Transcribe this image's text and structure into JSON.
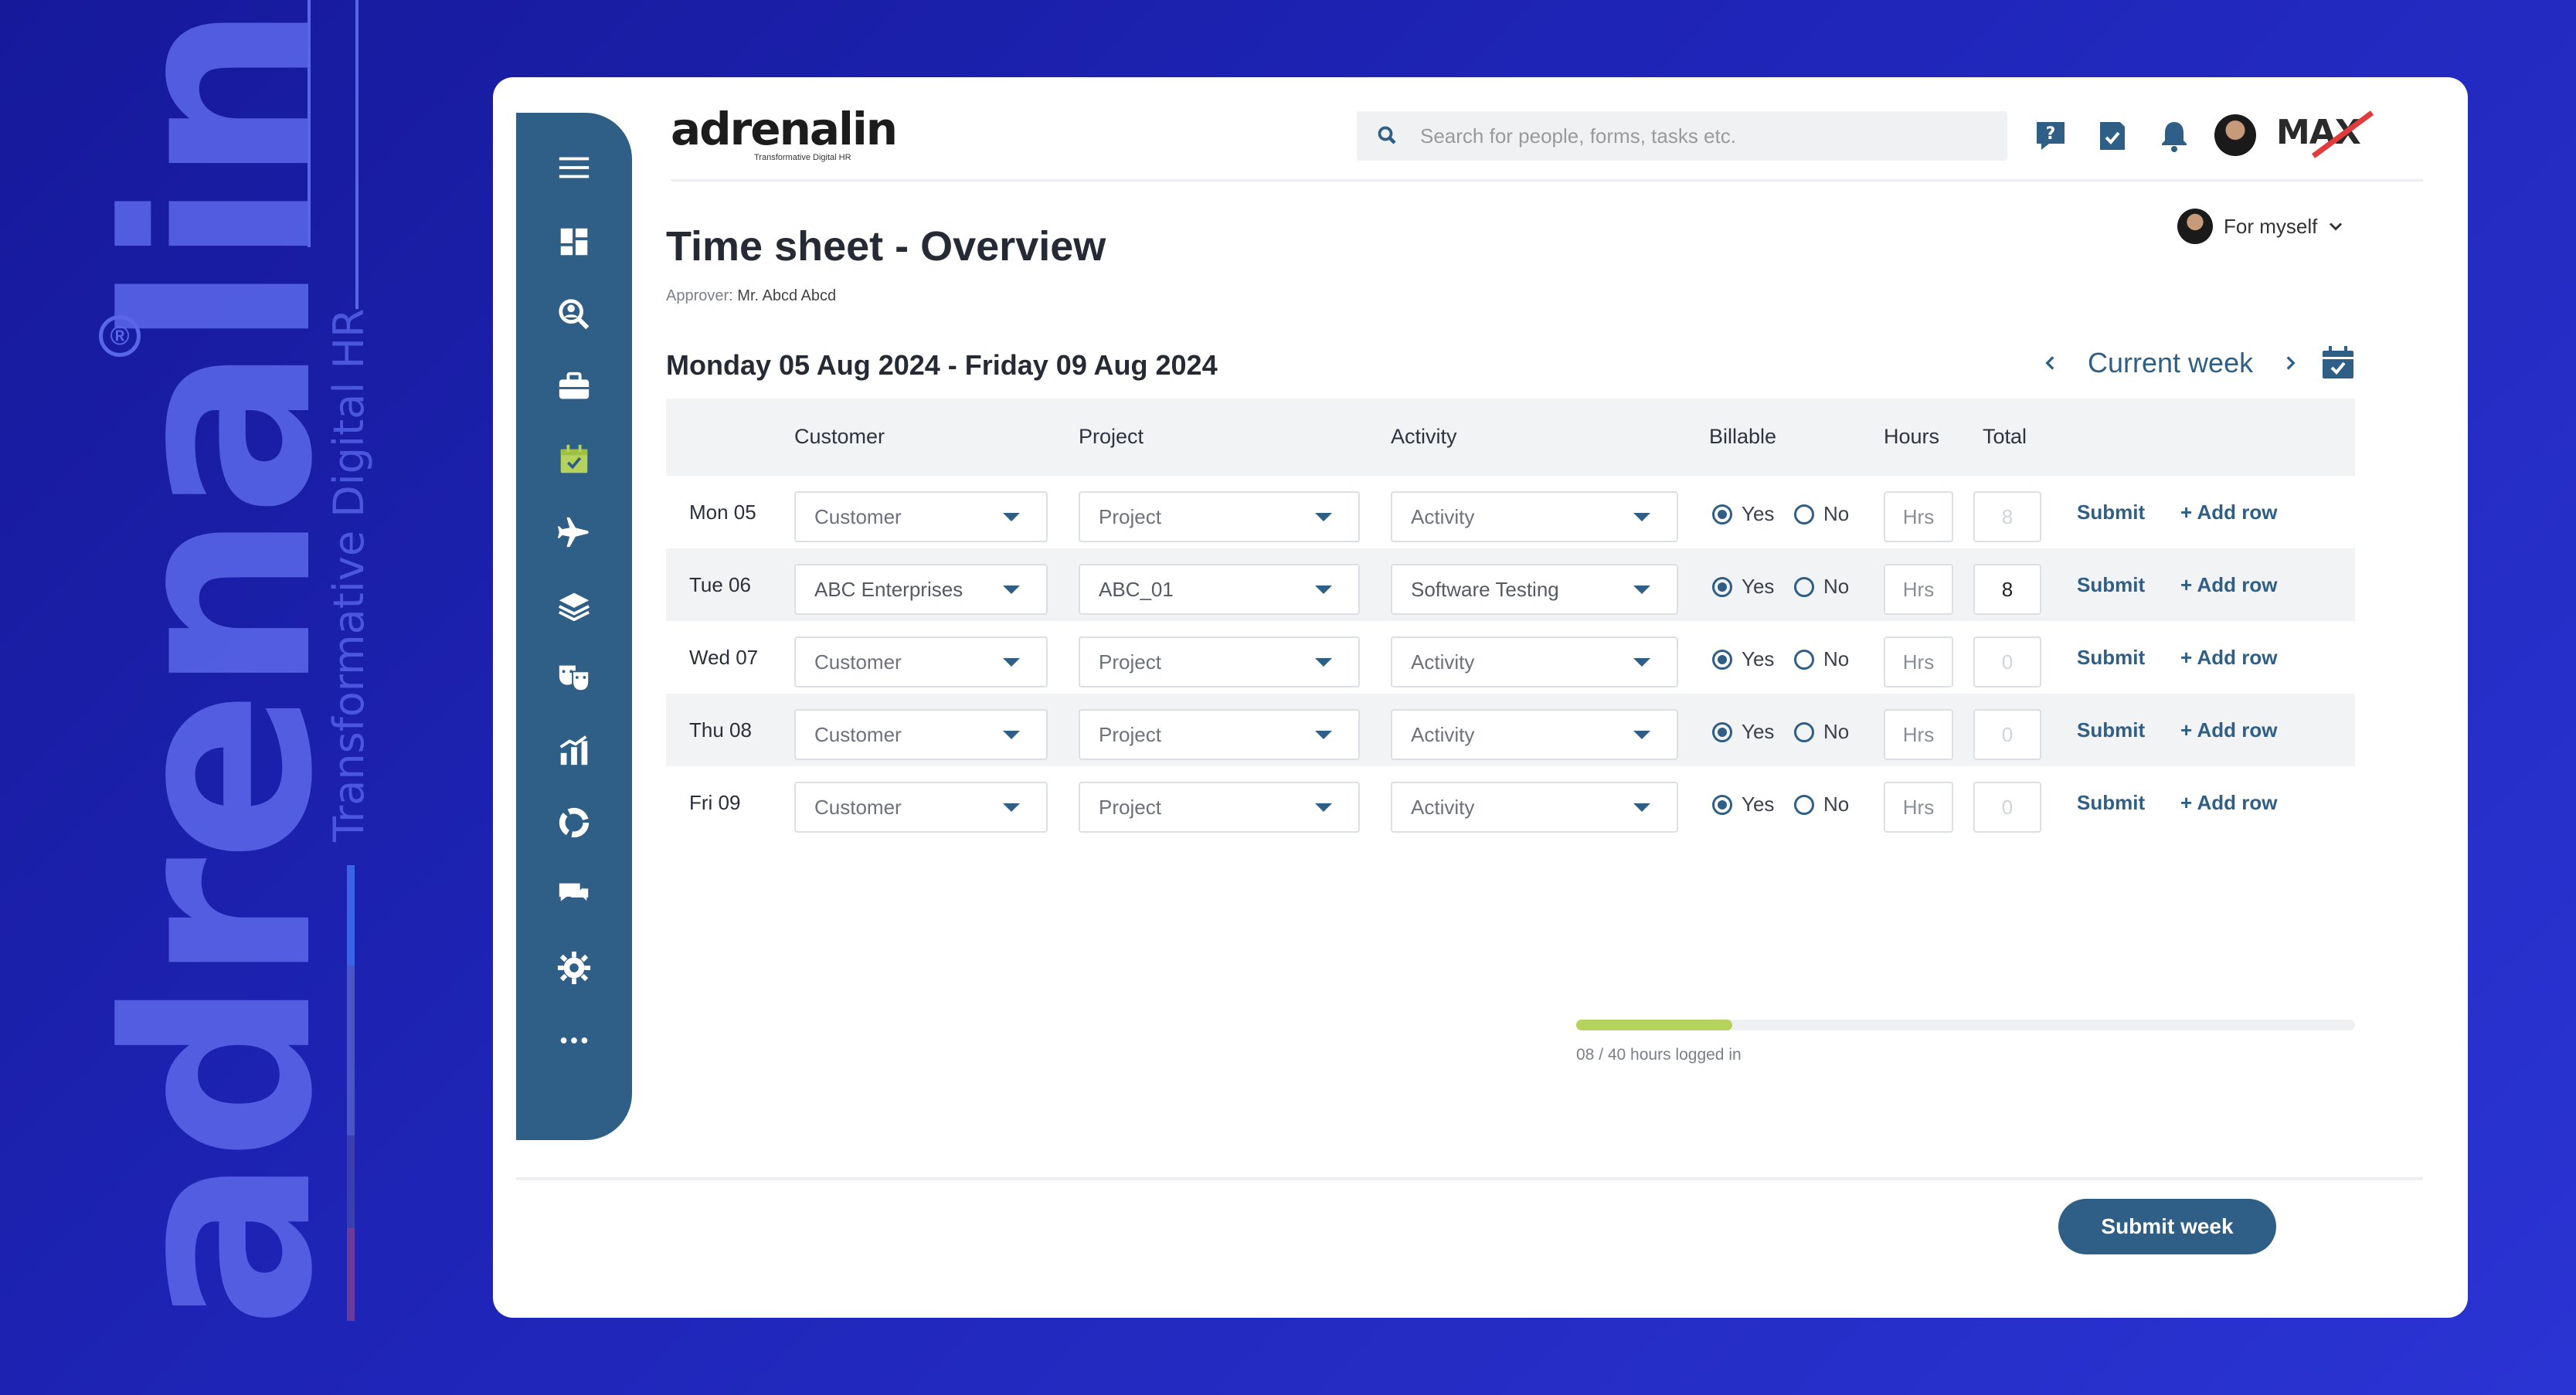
{
  "brand": {
    "name": "adrenalin",
    "registered": "®",
    "tagline": "Transformative Digital HR"
  },
  "header": {
    "logo_text": "adrenalin",
    "logo_sub": "Transformative Digital HR",
    "search_placeholder": "Search for people, forms, tasks etc.",
    "max_logo": "MAX"
  },
  "page": {
    "title": "Time sheet - Overview",
    "approver_label": "Approver:",
    "approver_name": "Mr. Abcd Abcd",
    "for_myself": "For myself",
    "week_range": "Monday 05 Aug 2024 - Friday 09 Aug 2024",
    "current_week": "Current week"
  },
  "table": {
    "headers": {
      "customer": "Customer",
      "project": "Project",
      "activity": "Activity",
      "billable": "Billable",
      "hours": "Hours",
      "total": "Total"
    },
    "yes_label": "Yes",
    "no_label": "No",
    "submit_label": "Submit",
    "add_row_label": "+ Add row",
    "rows": [
      {
        "day": "Mon 05",
        "customer": "Customer",
        "project": "Project",
        "activity": "Activity",
        "hours": "Hrs",
        "total": "8"
      },
      {
        "day": "Tue 06",
        "customer": "ABC Enterprises",
        "project": "ABC_01",
        "activity": "Software Testing",
        "hours": "Hrs",
        "total": "8"
      },
      {
        "day": "Wed 07",
        "customer": "Customer",
        "project": "Project",
        "activity": "Activity",
        "hours": "Hrs",
        "total": "0"
      },
      {
        "day": "Thu 08",
        "customer": "Customer",
        "project": "Project",
        "activity": "Activity",
        "hours": "Hrs",
        "total": "0"
      },
      {
        "day": "Fri  09",
        "customer": "Customer",
        "project": "Project",
        "activity": "Activity",
        "hours": "Hrs",
        "total": "0"
      }
    ]
  },
  "progress": {
    "label": "08 / 40 hours logged in",
    "logged": 8,
    "total": 40,
    "color": "#b5d25c"
  },
  "footer": {
    "submit_week": "Submit week"
  },
  "colors": {
    "primary": "#2f5f86",
    "accent_green": "#b5d25c",
    "background": "#1f25b8"
  },
  "sidebar_icons": [
    "menu-icon",
    "dashboard-icon",
    "people-search-icon",
    "briefcase-icon",
    "calendar-check-icon",
    "airplane-icon",
    "money-stack-icon",
    "masks-icon",
    "bar-chart-icon",
    "cycle-icon",
    "chat-icon",
    "gear-icon",
    "more-icon"
  ]
}
